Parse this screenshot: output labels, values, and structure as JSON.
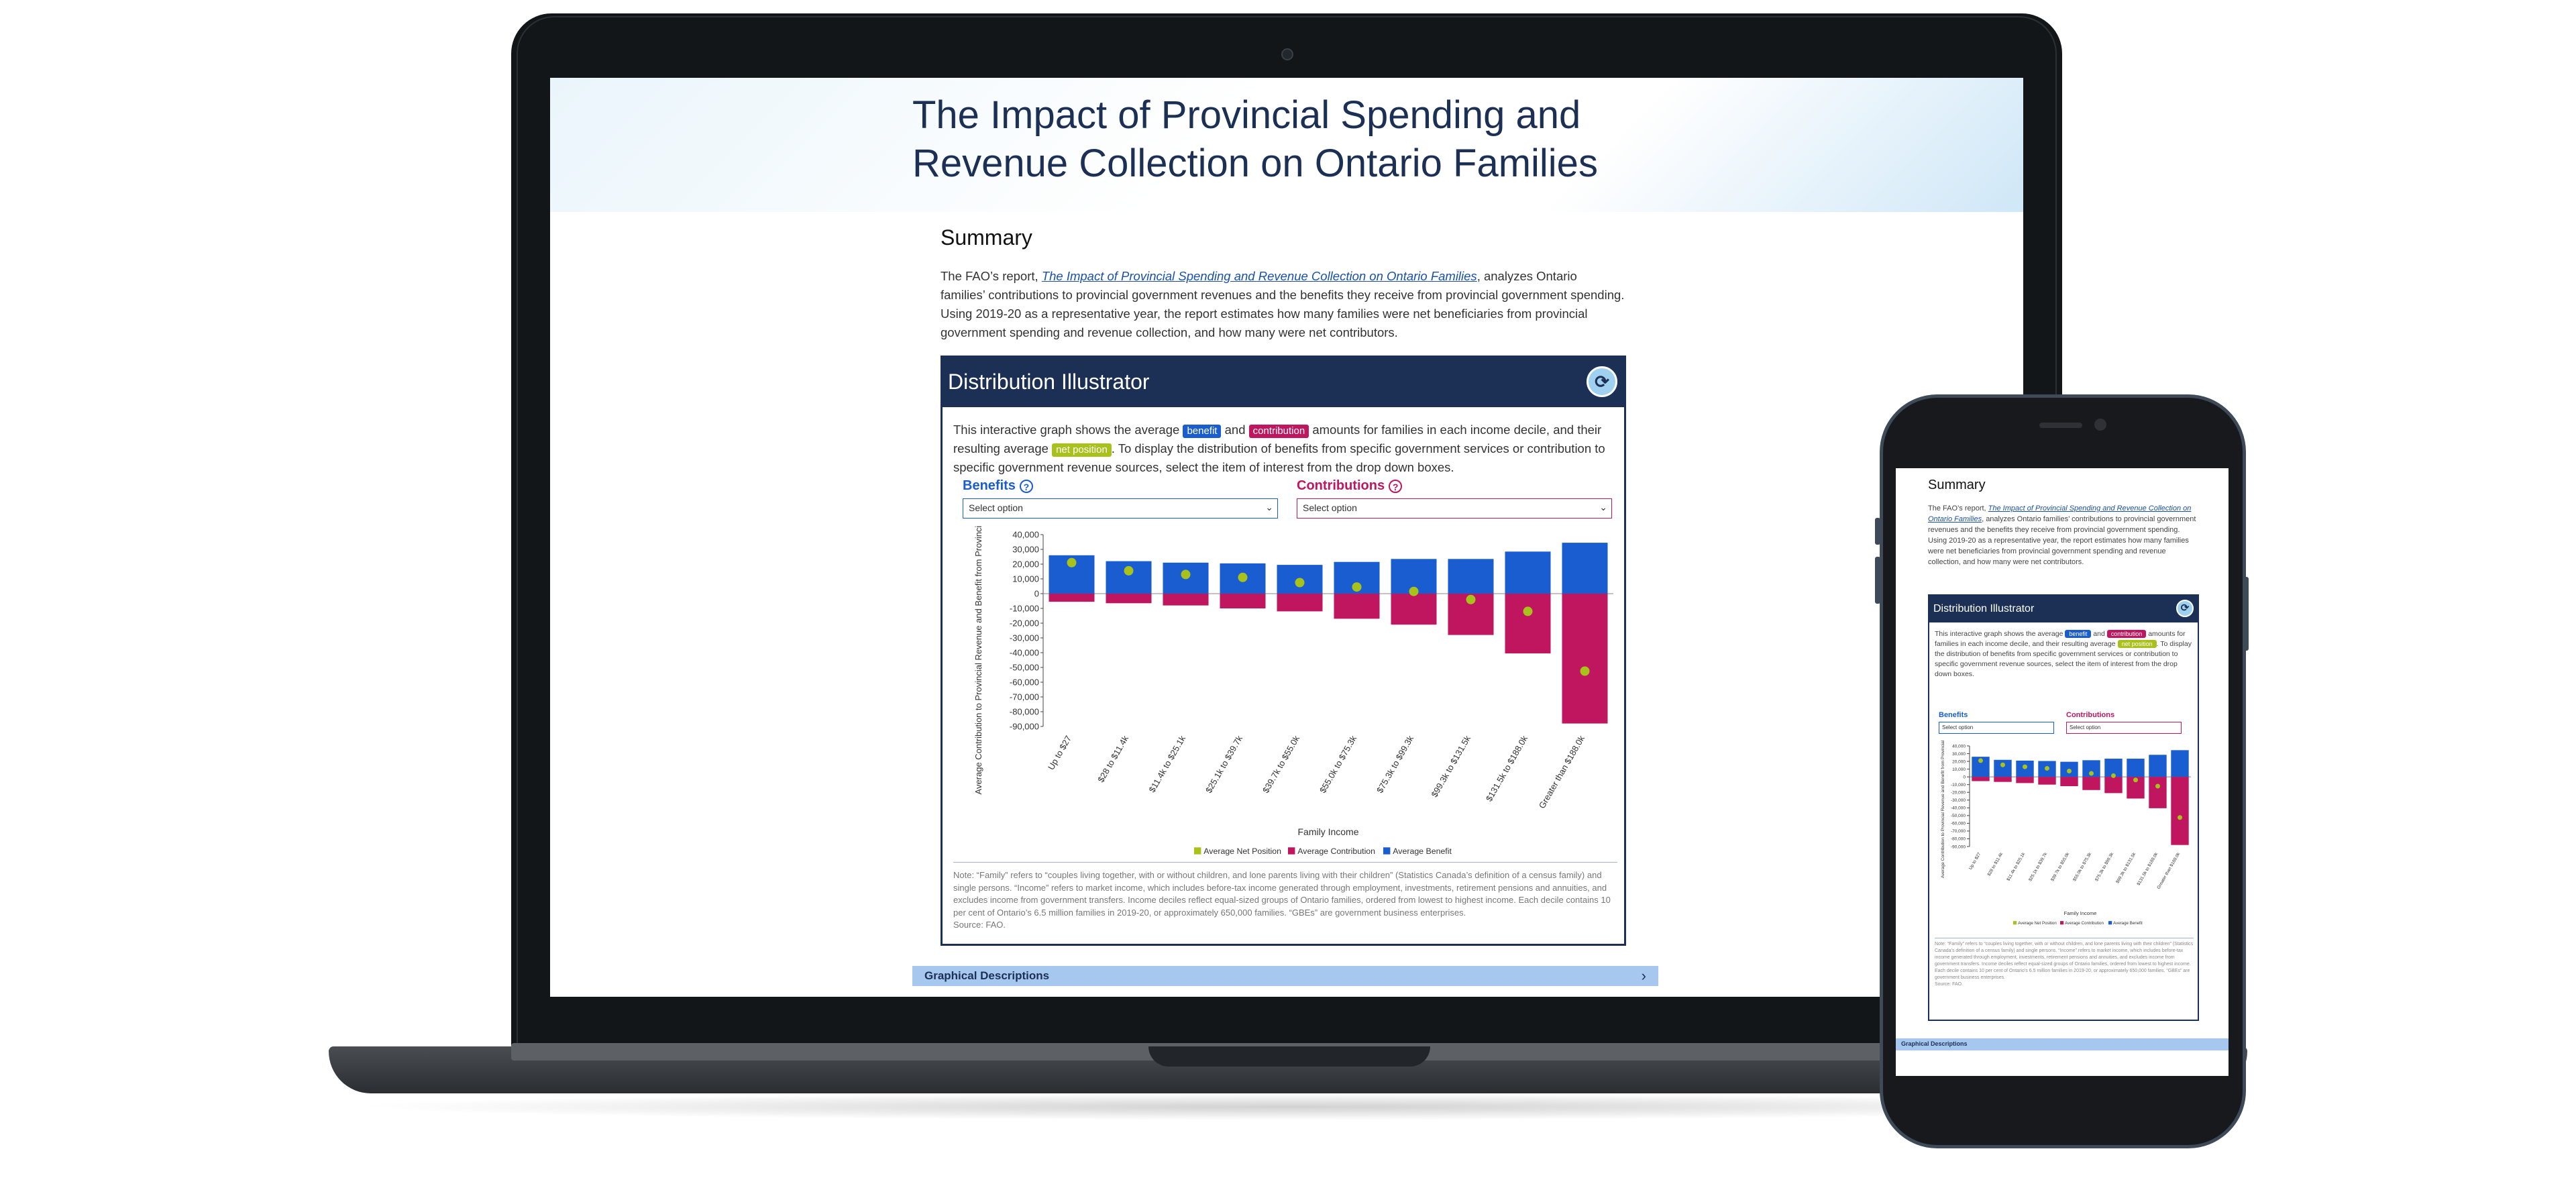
{
  "page": {
    "title": "The Impact of Provincial Spending and Revenue Collection on Ontario Families",
    "summary_heading": "Summary",
    "summary_pre": "The FAO’s report, ",
    "summary_link": "The Impact of Provincial Spending and Revenue Collection on Ontario Families",
    "summary_post": ", analyzes Ontario families’ contributions to provincial government revenues and the benefits they receive from provincial government spending. Using 2019-20 as a representative year, the report estimates how many families were net beneficiaries from provincial government spending and revenue collection, and how many were net contributors."
  },
  "illustrator": {
    "title": "Distribution Illustrator",
    "reset_icon": "refresh-icon",
    "intro_1": "This interactive graph shows the average ",
    "pill_benefit": "benefit",
    "intro_2": " and ",
    "pill_contribution": "contribution",
    "intro_3": " amounts for families in each income decile, and their resulting average ",
    "pill_net": "net position",
    "intro_4": ". To display the distribution of benefits from specific government services or contribution to specific government revenue sources, select the item of interest from the drop down boxes.",
    "benefits_label": "Benefits",
    "contributions_label": "Contributions",
    "help_glyph": "?",
    "benefits_select": "Select option",
    "contributions_select": "Select option",
    "note": "Note: “Family” refers to “couples living together, with or without children, and lone parents living with their children” (Statistics Canada’s definition of a census family) and single persons. “Income” refers to market income, which includes before-tax income generated through employment, investments, retirement pensions and annuities, and excludes income from government transfers. Income deciles reflect equal-sized groups of Ontario families, ordered from lowest to highest income. Each decile contains 10 per cent of Ontario’s 6.5 million families in 2019-20, or approximately 650,000 families. “GBEs” are government business enterprises.",
    "source": "Source: FAO."
  },
  "graphical_descriptions": {
    "label": "Graphical Descriptions",
    "chevron": "›"
  },
  "colors": {
    "benefit": "#1a5dd0",
    "contribution": "#c0155f",
    "net": "#a8c21b",
    "navy": "#1c2f55"
  },
  "chart_data": {
    "type": "bar",
    "categories": [
      "Up to $27",
      "$28 to $11.4k",
      "$11.4k to $25.1k",
      "$25.1k to $39.7k",
      "$39.7k to $55.0k",
      "$55.0k to $75.3k",
      "$75.3k to $99.3k",
      "$99.3k to $131.5k",
      "$131.5k to $188.0k",
      "Greater than $188.0k"
    ],
    "series": [
      {
        "name": "Average Benefit",
        "values": [
          26000,
          22000,
          21000,
          20500,
          19500,
          21500,
          23500,
          23500,
          28500,
          34500
        ]
      },
      {
        "name": "Average Contribution",
        "values": [
          -5500,
          -6500,
          -8000,
          -10000,
          -12000,
          -17000,
          -21000,
          -28000,
          -40500,
          -88000
        ]
      },
      {
        "name": "Average Net Position",
        "values": [
          21000,
          15500,
          13000,
          11000,
          7500,
          4500,
          1500,
          -4000,
          -12000,
          -52500
        ]
      }
    ],
    "ylabel": "Average Contribution to Provincial Revenue and Benefit from Provincial Spending ($)",
    "xlabel": "Family Income",
    "ylim": [
      -90000,
      40000
    ],
    "yticks": [
      "40,000",
      "30,000",
      "20,000",
      "10,000",
      "0",
      "-10,000",
      "-20,000",
      "-30,000",
      "-40,000",
      "-50,000",
      "-60,000",
      "-70,000",
      "-80,000",
      "-90,000"
    ],
    "legend": [
      "Average Net Position",
      "Average Contribution",
      "Average Benefit"
    ],
    "legend_position": "bottom",
    "grid": false
  }
}
